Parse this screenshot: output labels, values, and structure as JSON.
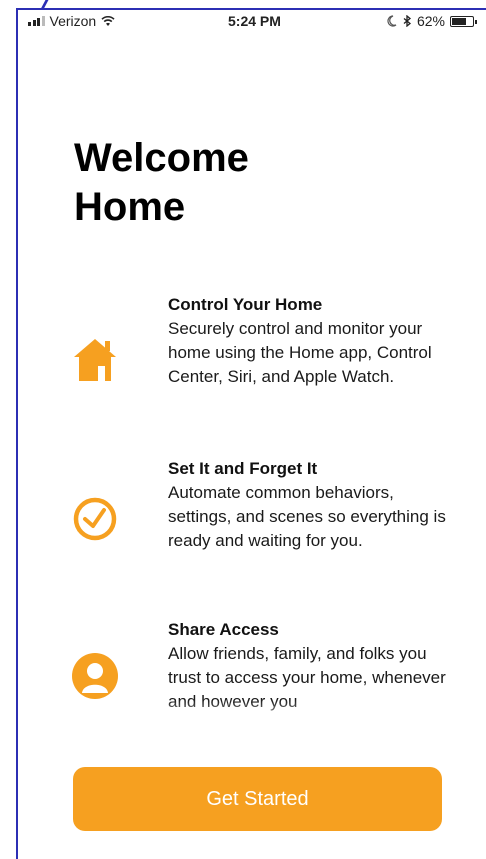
{
  "status_bar": {
    "carrier": "Verizon",
    "time": "5:24 PM",
    "battery": "62%"
  },
  "title_line1": "Welcome",
  "title_line2": "Home",
  "features": [
    {
      "icon": "house-icon",
      "heading": "Control Your Home",
      "body": "Securely control and monitor your home using the Home app, Control Center, Siri, and Apple Watch."
    },
    {
      "icon": "clock-icon",
      "heading": "Set It and Forget It",
      "body": "Automate common behaviors, settings, and scenes so everything is ready and waiting for you."
    },
    {
      "icon": "person-icon",
      "heading": "Share Access",
      "body": "Allow friends, family, and folks you trust to access your home, whenever and however you"
    }
  ],
  "button": {
    "label": "Get Started"
  },
  "colors": {
    "accent": "#f6a020",
    "frame": "#2c2fb4"
  }
}
